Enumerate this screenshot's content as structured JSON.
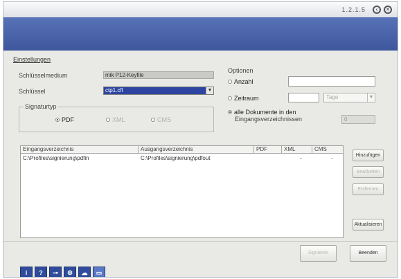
{
  "window": {
    "version": "1.2.1.5"
  },
  "settings": {
    "title": "Einstellungen",
    "key_medium_label": "Schlüsselmedium",
    "key_medium_value": "mik P12-Keyfile",
    "key_label": "Schlüssel",
    "key_value": "ctp1.cfl",
    "signature_type": {
      "title": "Signaturtyp",
      "options": [
        {
          "label": "PDF",
          "selected": true,
          "enabled": true
        },
        {
          "label": "XML",
          "selected": false,
          "enabled": false
        },
        {
          "label": "CMS",
          "selected": false,
          "enabled": false
        }
      ]
    }
  },
  "options": {
    "title": "Optionen",
    "count_label": "Anzahl",
    "time_label": "Zeitraum",
    "time_unit": "Tage",
    "all_docs_label_line1": "alle Dokumente in den",
    "all_docs_label_line2": "Eingangsverzeichnissen",
    "all_docs_value": "0",
    "selected_option": "all_docs"
  },
  "table": {
    "headers": [
      "Eingangsverzeichnis",
      "Ausgangsverzeichnis",
      "PDF",
      "XML",
      "CMS"
    ],
    "rows": [
      [
        "C:\\Profiles\\signierung\\pdfin",
        "C:\\Profiles\\signierung\\pdfout",
        "",
        "-",
        "-"
      ]
    ]
  },
  "side_buttons": {
    "add": "Hinzufügen",
    "edit": "Bearbeiten",
    "delete": "Entfernen",
    "refresh": "Aktualisieren"
  },
  "bottom_buttons": {
    "sign": "Signieren",
    "quit": "Beenden"
  },
  "toolbar": {
    "icons": [
      "info-icon",
      "help-icon",
      "key-icon",
      "settings-icon",
      "cloud-icon",
      "window-icon"
    ]
  },
  "colors": {
    "header_band": "#4a64aa",
    "selection": "#2d45a0",
    "window_bg": "#e9e9e6"
  }
}
